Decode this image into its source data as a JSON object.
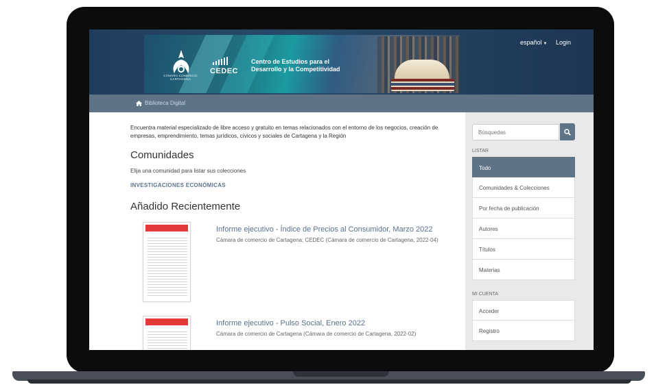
{
  "header": {
    "org_name": "CÁMARA COMERCIO",
    "org_city": "CARTAGENA",
    "brand": "CEDEC",
    "brand_line1": "Centro de Estudios para el",
    "brand_line2": "Desarrollo y la Competitividad",
    "language": "español",
    "login": "Login"
  },
  "breadcrumb": {
    "home": "Biblioteca Digital"
  },
  "main": {
    "intro": "Encuentra material especializado de libre acceso y gratuito en temas relacionados con el entorno de los negocios, creación de empresas, emprendimiento, temas jurídicos, cívicos y sociales de Cartagena y la Región",
    "communities_heading": "Comunidades",
    "communities_hint": "Elija una comunidad para listar sus colecciones",
    "community_link": "INVESTIGACIONES ECONÓMICAS",
    "recent_heading": "Añadido Recientemente",
    "items": [
      {
        "title": "Informe ejecutivo - Índice de Precios al Consumidor, Marzo 2022",
        "meta": "Cámara de comercio de Cartagena; CEDEC (Cámara de comercio de Cartagena, 2022-04)"
      },
      {
        "title": "Informe ejecutivo - Pulso Social, Enero 2022",
        "meta": "Cámara de comercio de Cartagena (Cámara de comercio de Cartagena, 2022-02)"
      }
    ]
  },
  "sidebar": {
    "search_placeholder": "Búsquedas",
    "browse_label": "LISTAR",
    "browse_items": [
      "Todo",
      "Comunidades & Colecciones",
      "Por fecha de publicación",
      "Autores",
      "Títulos",
      "Materias"
    ],
    "account_label": "MI CUENTA",
    "account_items": [
      "Acceder",
      "Registro"
    ]
  },
  "colors": {
    "header_bg": "#213d5d",
    "nav_bar": "#5f7386",
    "active_item": "#5f7386",
    "link": "#5b6f8a",
    "thumb_accent": "#e23a3a"
  },
  "icons": [
    "home-icon",
    "search-icon",
    "caret-down-icon",
    "camara-logo-icon",
    "cedec-bars-icon"
  ]
}
